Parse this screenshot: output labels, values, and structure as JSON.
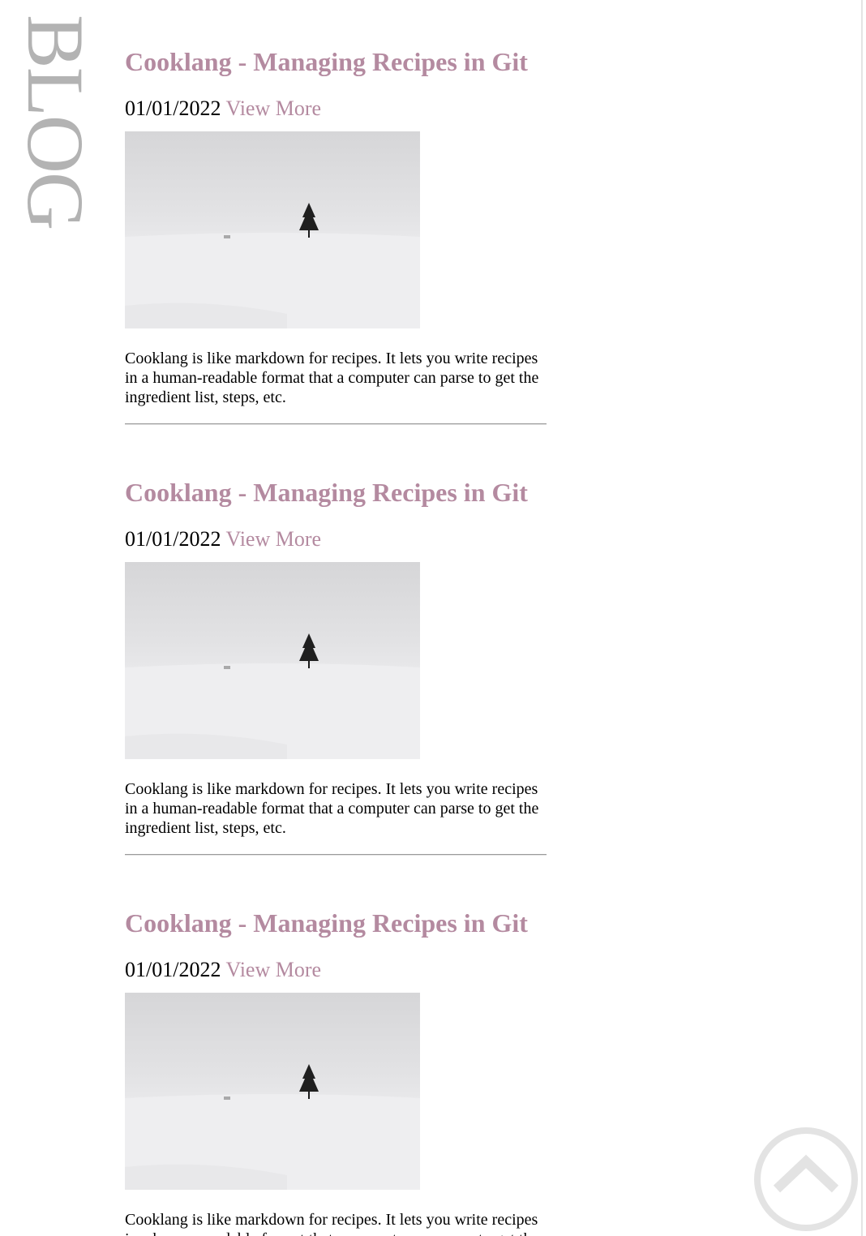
{
  "sidebar": {
    "title": "BLOG"
  },
  "posts": [
    {
      "title": "Cooklang - Managing Recipes in Git",
      "date": "01/01/2022",
      "view_more": "View More",
      "image_alt": "Lone tree on a snowy hill",
      "excerpt": "Cooklang is like markdown for recipes. It lets you write recipes in a human-readable format that a computer can parse to get the ingredient list, steps, etc."
    },
    {
      "title": "Cooklang - Managing Recipes in Git",
      "date": "01/01/2022",
      "view_more": "View More",
      "image_alt": "Lone tree on a snowy hill",
      "excerpt": "Cooklang is like markdown for recipes. It lets you write recipes in a human-readable format that a computer can parse to get the ingredient list, steps, etc."
    },
    {
      "title": "Cooklang - Managing Recipes in Git",
      "date": "01/01/2022",
      "view_more": "View More",
      "image_alt": "Lone tree on a snowy hill",
      "excerpt": "Cooklang is like markdown for recipes. It lets you write recipes in a human-readable format that a computer can parse to get the ingredient list, steps, etc."
    }
  ],
  "scroll_to_top": {
    "icon": "chevron-up-circle-icon"
  },
  "colors": {
    "accent": "#b48aa0",
    "sidebar_text": "#b3b3b3",
    "body_text": "#000000",
    "icon_gray": "#e3e3e3"
  }
}
